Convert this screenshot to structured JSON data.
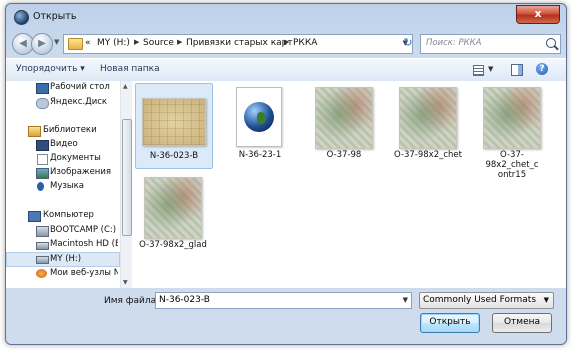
{
  "window": {
    "title": "Открыть",
    "close_label": "x"
  },
  "nav": {
    "back": "◀",
    "forward": "▶"
  },
  "address": {
    "prefix": "«",
    "crumbs": [
      "MY (H:)",
      "Source",
      "Привязки старых карт",
      "РККА"
    ],
    "search_placeholder": "Поиск: РККА"
  },
  "toolbar": {
    "organize": "Упорядочить ▾",
    "new_folder": "Новая папка",
    "help": "?"
  },
  "sidebar": {
    "items": [
      {
        "label": "Рабочий стол",
        "icon": "desktop-icon"
      },
      {
        "label": "Яндекс.Диск",
        "icon": "cloud-icon"
      },
      {
        "label": "Библиотеки",
        "icon": "library-icon"
      },
      {
        "label": "Видео",
        "icon": "video-icon"
      },
      {
        "label": "Документы",
        "icon": "document-icon"
      },
      {
        "label": "Изображения",
        "icon": "image-icon"
      },
      {
        "label": "Музыка",
        "icon": "music-icon"
      },
      {
        "label": "Компьютер",
        "icon": "computer-icon"
      },
      {
        "label": "BOOTCAMP (C:)",
        "icon": "drive-icon"
      },
      {
        "label": "Macintosh HD (E",
        "icon": "drive-icon"
      },
      {
        "label": "MY (H:)",
        "icon": "drive-icon"
      },
      {
        "label": "Мои веб-узлы N",
        "icon": "web-icon"
      }
    ]
  },
  "files": [
    {
      "name": "N-36-023-B",
      "kind": "old-map",
      "selected": true
    },
    {
      "name": "N-36-23-1",
      "kind": "globe"
    },
    {
      "name": "O-37-98",
      "kind": "map"
    },
    {
      "name": "O-37-98x2_chet",
      "kind": "map"
    },
    {
      "name": "O-37-98x2_chet_c\nontr15",
      "kind": "map"
    },
    {
      "name": "O-37-98x2_glad",
      "kind": "map"
    }
  ],
  "bottom": {
    "filename_label": "Имя файла:",
    "filename_value": "N-36-023-B",
    "filter_value": "Commonly Used Formats",
    "open_label": "Открыть",
    "cancel_label": "Отмена"
  }
}
